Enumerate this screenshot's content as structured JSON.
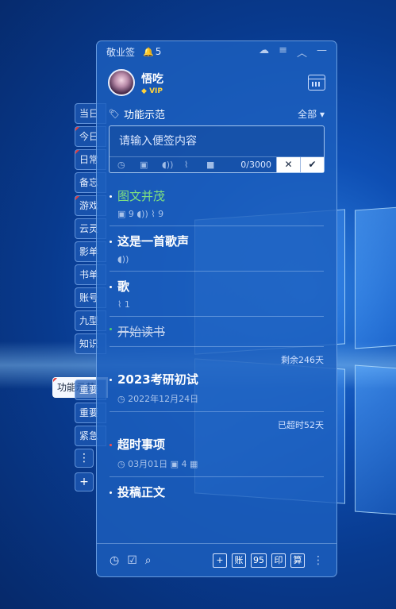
{
  "app": {
    "title": "敬业签",
    "reminder_count": "5"
  },
  "user": {
    "name": "悟吃",
    "badge": "VIP"
  },
  "category": {
    "current": "功能示范",
    "filter": "全部"
  },
  "input": {
    "placeholder": "请输入便签内容",
    "counter": "0/3000"
  },
  "side_tabs": [
    "当日",
    "今日",
    "日常",
    "备忘",
    "游戏",
    "云灵",
    "影单",
    "书单",
    "账号",
    "九型",
    "知识"
  ],
  "side_active": "功能示范",
  "side_tabs_more": [
    "重要",
    "重要",
    "紧急"
  ],
  "notes": [
    {
      "title": "图文并茂",
      "meta": "▣ 9  ◖)) ⌇ 9"
    },
    {
      "title": "这是一首歌声",
      "meta": "◖))"
    },
    {
      "title": "歌",
      "meta": "⌇ 1"
    },
    {
      "title": "开始读书",
      "meta": ""
    },
    {
      "title": "2023考研初试",
      "remain": "剩余246天",
      "meta": "◷ 2022年12月24日"
    },
    {
      "title": "超时事项",
      "remain": "已超时52天",
      "meta": "◷ 03月01日  ▣ 4  ▦"
    },
    {
      "title": "投稿正文",
      "meta": ""
    }
  ],
  "toolbar": {
    "tools": [
      "+",
      "账",
      "95",
      "印",
      "算"
    ]
  },
  "colors": {
    "panel": "#1c5fbe",
    "green_title": "#7fe07f",
    "vip": "#ffd33b",
    "flag": "#e23b3b"
  }
}
